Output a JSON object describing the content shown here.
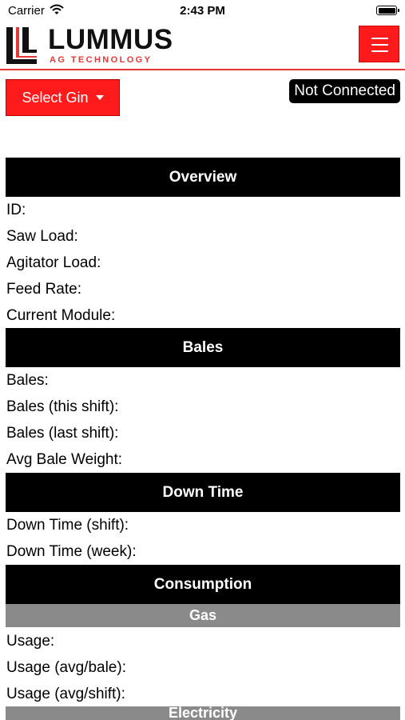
{
  "status_bar": {
    "carrier": "Carrier",
    "time": "2:43 PM"
  },
  "header": {
    "logo_main": "LUMMUS",
    "logo_sub": "AG TECHNOLOGY"
  },
  "controls": {
    "select_gin_label": "Select Gin",
    "connection_status": "Not Connected"
  },
  "sections": {
    "overview": {
      "title": "Overview",
      "fields": [
        "ID:",
        "Saw Load:",
        "Agitator Load:",
        "Feed Rate:",
        "Current Module:"
      ]
    },
    "bales": {
      "title": "Bales",
      "fields": [
        "Bales:",
        "Bales (this shift):",
        "Bales (last shift):",
        "Avg Bale Weight:"
      ]
    },
    "down_time": {
      "title": "Down Time",
      "fields": [
        "Down Time (shift):",
        "Down Time (week):"
      ]
    },
    "consumption": {
      "title": "Consumption",
      "gas": {
        "title": "Gas",
        "fields": [
          "Usage:",
          "Usage (avg/bale):",
          "Usage (avg/shift):"
        ]
      },
      "electricity": {
        "title": "Electricity"
      }
    }
  },
  "colors": {
    "brand_red": "#ff1b1b",
    "header_black": "#000000",
    "subheader_gray": "#8a8a8a"
  }
}
